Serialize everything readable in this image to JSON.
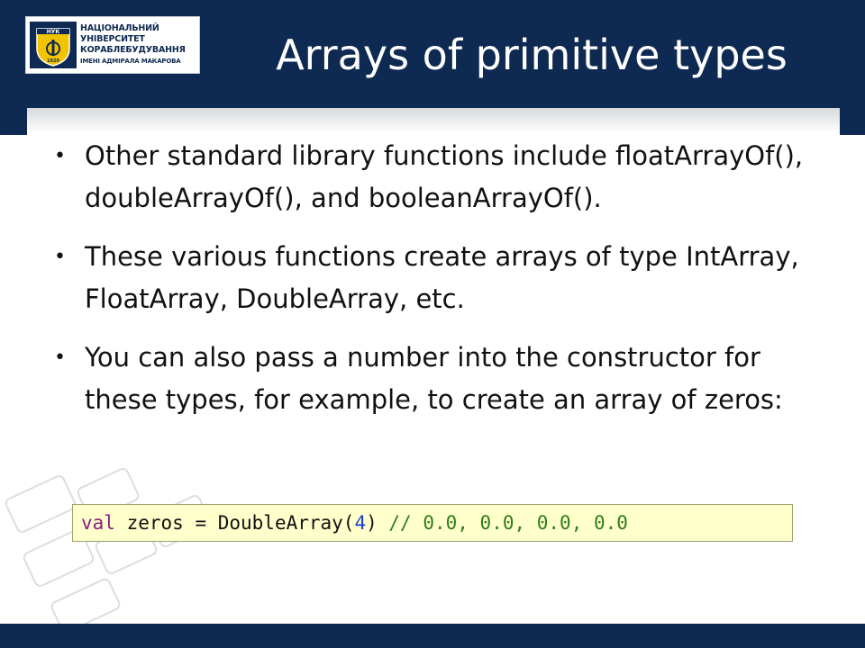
{
  "header": {
    "logo_lines": [
      "НАЦІОНАЛЬНИЙ",
      "УНІВЕРСИТЕТ",
      "КОРАБЛЕБУДУВАННЯ",
      "ІМЕНІ АДМІРАЛА МАКАРОВА"
    ],
    "emblem_letters": "НУК",
    "emblem_year": "1920",
    "title": "Arrays of primitive types"
  },
  "body": {
    "bullets": [
      "Other standard library functions include floatArrayOf(), doubleArrayOf(), and booleanArrayOf().",
      "These various functions create arrays of type IntArray, FloatArray, DoubleArray, etc.",
      "You can also pass a number into the constructor for these types, for example, to create an array of zeros:"
    ],
    "bullet_symbol": "•",
    "code": {
      "keyword": "val",
      "text_before_number": " zeros = DoubleArray(",
      "number": "4",
      "text_after_number": ") ",
      "comment": "// 0.0, 0.0, 0.0, 0.0"
    }
  },
  "colors": {
    "header_bg": "#0f2a52",
    "emblem_yellow": "#f2c400",
    "code_bg": "#ffffcc",
    "keyword": "#8a1c84",
    "number": "#1f3fd0",
    "comment": "#2f7d1a"
  },
  "icons": {
    "emblem": "university-shield-icon",
    "background": "keyboard-decoration-icon"
  }
}
